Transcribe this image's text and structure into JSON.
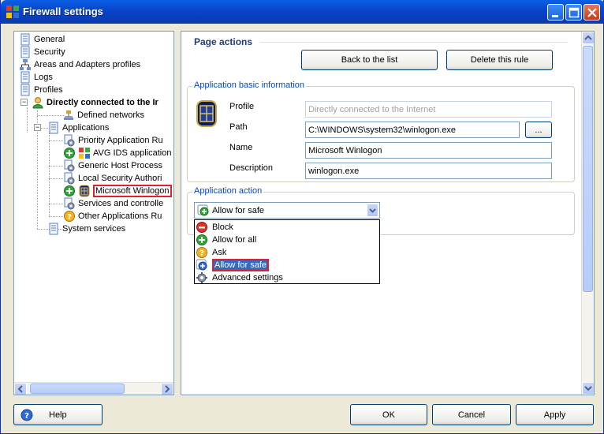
{
  "window": {
    "title": "Firewall settings"
  },
  "tree": {
    "items": [
      {
        "label": "General",
        "icon": "document-icon"
      },
      {
        "label": "Security",
        "icon": "document-icon"
      },
      {
        "label": "Areas and Adapters profiles",
        "icon": "network-icon"
      },
      {
        "label": "Logs",
        "icon": "document-icon"
      },
      {
        "label": "Profiles",
        "icon": "document-icon"
      },
      {
        "label": "Directly connected to the Ir",
        "icon": "user-profile-icon"
      },
      {
        "label": "Defined networks",
        "icon": "network-icon"
      },
      {
        "label": "Applications",
        "icon": "document-icon"
      },
      {
        "label": "Priority Application Ru",
        "icon": "gear-doc-icon"
      },
      {
        "label": "AVG IDS application",
        "icon": "avg-icon"
      },
      {
        "label": "Generic Host Process",
        "icon": "gear-doc-icon"
      },
      {
        "label": "Local Security Authori",
        "icon": "gear-doc-icon"
      },
      {
        "label": "Microsoft Winlogon",
        "icon": "winlogon-icon"
      },
      {
        "label": "Services and controlle",
        "icon": "gear-doc-icon"
      },
      {
        "label": "Other Applications Ru",
        "icon": "question-icon"
      },
      {
        "label": "System services",
        "icon": "document-icon"
      }
    ]
  },
  "page_actions": {
    "title": "Page actions",
    "back_label": "Back to the list",
    "delete_label": "Delete this rule"
  },
  "app_info": {
    "legend": "Application basic information",
    "profile_label": "Profile",
    "profile_value": "Directly connected to the Internet",
    "path_label": "Path",
    "path_value": "C:\\WINDOWS\\system32\\winlogon.exe",
    "browse_label": "...",
    "name_label": "Name",
    "name_value": "Microsoft Winlogon",
    "description_label": "Description",
    "description_value": "winlogon.exe"
  },
  "app_action": {
    "legend": "Application action",
    "selected": "Allow for safe",
    "options": [
      {
        "label": "Block",
        "icon": "block-icon"
      },
      {
        "label": "Allow for all",
        "icon": "allow-all-icon"
      },
      {
        "label": "Ask",
        "icon": "ask-icon"
      },
      {
        "label": "Allow for safe",
        "icon": "allow-safe-icon"
      },
      {
        "label": "Advanced settings",
        "icon": "advanced-gear-icon"
      }
    ]
  },
  "footer": {
    "help_label": "Help",
    "ok_label": "OK",
    "cancel_label": "Cancel",
    "apply_label": "Apply"
  }
}
